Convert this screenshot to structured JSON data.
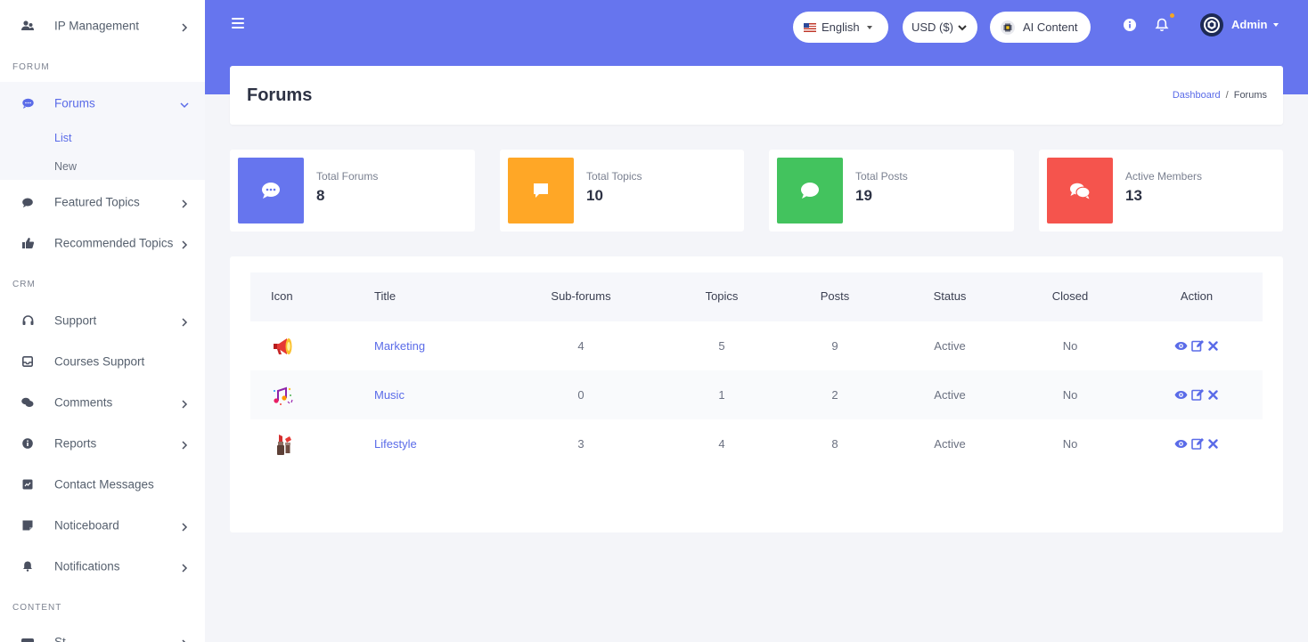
{
  "sidebar": {
    "ip_management": "IP Management",
    "section_forum": "FORUM",
    "forums": "Forums",
    "sub_list": "List",
    "sub_new": "New",
    "featured_topics": "Featured Topics",
    "recommended_topics": "Recommended Topics",
    "section_crm": "CRM",
    "support": "Support",
    "courses_support": "Courses Support",
    "comments": "Comments",
    "reports": "Reports",
    "contact_messages": "Contact Messages",
    "noticeboard": "Noticeboard",
    "notifications": "Notifications",
    "section_content": "CONTENT",
    "partial_item": "St"
  },
  "header": {
    "language": "English",
    "currency": "USD ($)",
    "ai_content": "AI Content",
    "admin": "Admin"
  },
  "page": {
    "title": "Forums",
    "breadcrumb_home": "Dashboard",
    "breadcrumb_separator": "/",
    "breadcrumb_current": "Forums"
  },
  "stats": [
    {
      "label": "Total Forums",
      "value": "8",
      "color": "#6675ee"
    },
    {
      "label": "Total Topics",
      "value": "10",
      "color": "#ffa726"
    },
    {
      "label": "Total Posts",
      "value": "19",
      "color": "#43c35e"
    },
    {
      "label": "Active Members",
      "value": "13",
      "color": "#f5544d"
    }
  ],
  "table": {
    "headers": {
      "icon": "Icon",
      "title": "Title",
      "subforums": "Sub-forums",
      "topics": "Topics",
      "posts": "Posts",
      "status": "Status",
      "closed": "Closed",
      "action": "Action"
    },
    "rows": [
      {
        "title": "Marketing",
        "subforums": "4",
        "topics": "5",
        "posts": "9",
        "status": "Active",
        "closed": "No",
        "icon": "megaphone-icon"
      },
      {
        "title": "Music",
        "subforums": "0",
        "topics": "1",
        "posts": "2",
        "status": "Active",
        "closed": "No",
        "icon": "music-notes-icon"
      },
      {
        "title": "Lifestyle",
        "subforums": "3",
        "topics": "4",
        "posts": "8",
        "status": "Active",
        "closed": "No",
        "icon": "lipstick-icon"
      }
    ]
  },
  "colors": {
    "accent": "#6675ee",
    "link": "#5a6be8"
  }
}
